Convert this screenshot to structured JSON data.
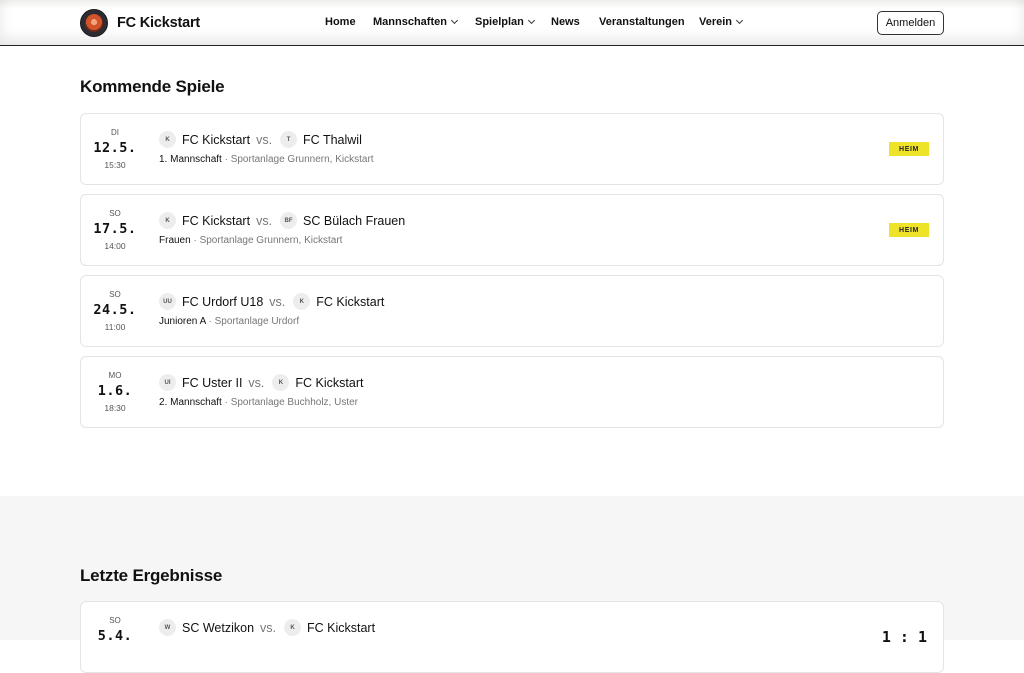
{
  "header": {
    "brand": "FC Kickstart",
    "nav": [
      {
        "label": "Home",
        "dropdown": false
      },
      {
        "label": "Mannschaften",
        "dropdown": true
      },
      {
        "label": "Spielplan",
        "dropdown": true
      },
      {
        "label": "News",
        "dropdown": false
      },
      {
        "label": "Veranstaltungen",
        "dropdown": false
      },
      {
        "label": "Verein",
        "dropdown": true
      }
    ],
    "login_label": "Anmelden"
  },
  "upcoming": {
    "title": "Kommende Spiele",
    "matches": [
      {
        "dow": "DI",
        "date": "12.5.",
        "time": "15:30",
        "home": {
          "abbr": "K",
          "name": "FC Kickstart"
        },
        "away": {
          "abbr": "T",
          "name": "FC Thalwil"
        },
        "vs": "vs.",
        "team": "1. Mannschaft",
        "sep": " · ",
        "venue": "Sportanlage Grunnern, Kickstart",
        "badge": "HEIM"
      },
      {
        "dow": "SO",
        "date": "17.5.",
        "time": "14:00",
        "home": {
          "abbr": "K",
          "name": "FC Kickstart"
        },
        "away": {
          "abbr": "BF",
          "name": "SC Bülach Frauen"
        },
        "vs": "vs.",
        "team": "Frauen",
        "sep": " · ",
        "venue": "Sportanlage Grunnern, Kickstart",
        "badge": "HEIM"
      },
      {
        "dow": "SO",
        "date": "24.5.",
        "time": "11:00",
        "home": {
          "abbr": "UU",
          "name": "FC Urdorf U18"
        },
        "away": {
          "abbr": "K",
          "name": "FC Kickstart"
        },
        "vs": "vs.",
        "team": "Junioren A",
        "sep": " · ",
        "venue": "Sportanlage Urdorf",
        "badge": ""
      },
      {
        "dow": "MO",
        "date": "1.6.",
        "time": "18:30",
        "home": {
          "abbr": "UI",
          "name": "FC Uster II"
        },
        "away": {
          "abbr": "K",
          "name": "FC Kickstart"
        },
        "vs": "vs.",
        "team": "2. Mannschaft",
        "sep": " · ",
        "venue": "Sportanlage Buchholz, Uster",
        "badge": ""
      }
    ]
  },
  "results": {
    "title": "Letzte Ergebnisse",
    "matches": [
      {
        "dow": "SO",
        "date": "5.4.",
        "home": {
          "abbr": "W",
          "name": "SC Wetzikon"
        },
        "away": {
          "abbr": "K",
          "name": "FC Kickstart"
        },
        "vs": "vs.",
        "score": "1 : 1"
      }
    ]
  }
}
